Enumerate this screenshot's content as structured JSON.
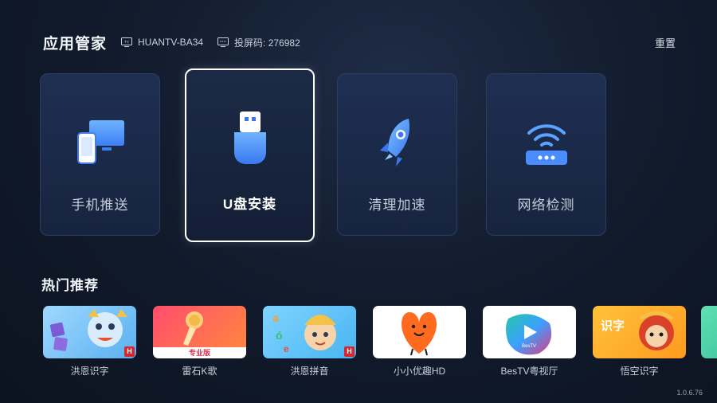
{
  "header": {
    "title": "应用管家",
    "device_name": "HUANTV-BA34",
    "cast_code": "投屏码: 276982",
    "reset_label": "重置"
  },
  "tools": [
    {
      "label": "手机推送",
      "icon": "phone-push-icon",
      "focused": false
    },
    {
      "label": "U盘安装",
      "icon": "usb-drive-icon",
      "focused": true
    },
    {
      "label": "清理加速",
      "icon": "rocket-icon",
      "focused": false
    },
    {
      "label": "网络检测",
      "icon": "router-wifi-icon",
      "focused": false
    }
  ],
  "section": {
    "hot_title": "热门推荐"
  },
  "apps": [
    {
      "name": "洪恩识字",
      "badge": "H",
      "badge_visible": true
    },
    {
      "name": "雷石K歌",
      "sublabel": "专业版"
    },
    {
      "name": "洪恩拼音",
      "badge": "H",
      "badge_visible": true
    },
    {
      "name": "小小优趣HD"
    },
    {
      "name": "BesTV粤视厅",
      "sublabel": "BesTV"
    },
    {
      "name": "悟空识字",
      "sublabel": "识字"
    }
  ],
  "footer": {
    "version": "1.0.6.76"
  },
  "colors": {
    "accent_blue": "#4a8dff",
    "background": "#121c2e",
    "focus_border": "#ffffff"
  }
}
